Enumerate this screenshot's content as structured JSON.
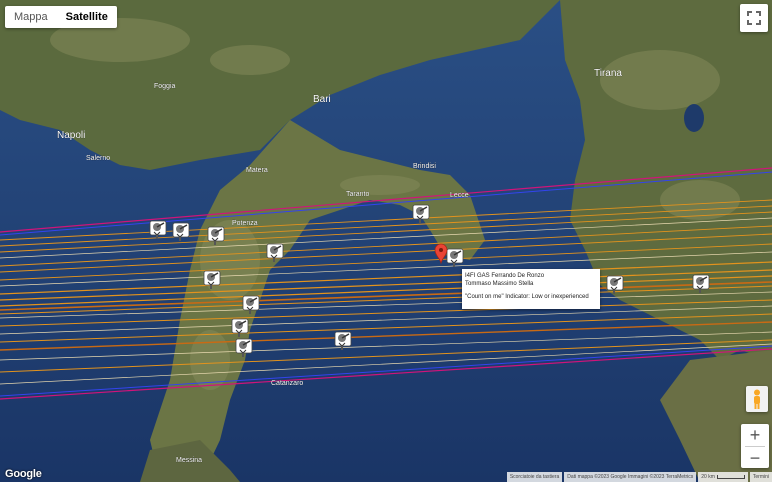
{
  "map_type_control": {
    "map_label": "Mappa",
    "satellite_label": "Satellite",
    "active": "satellite"
  },
  "cities": [
    {
      "name": "Bari"
    },
    {
      "name": "Napoli"
    },
    {
      "name": "Brindisi"
    },
    {
      "name": "Tirana"
    },
    {
      "name": "Salerno"
    },
    {
      "name": "Potenza"
    },
    {
      "name": "Taranto"
    },
    {
      "name": "Matera"
    },
    {
      "name": "Lecce"
    },
    {
      "name": "Catanzaro"
    },
    {
      "name": "Messina"
    },
    {
      "name": "Foggia"
    }
  ],
  "info_window": {
    "line1": "I4FI GAS Ferrando De Ronzo",
    "line2": "Tommaso Massimo Stella",
    "line3": "\"Count on me\" Indicator: Low or inexperienced"
  },
  "attribution": {
    "shortcuts": "Scorciatoie da tastiera",
    "data": "Dati mappa ©2023 Google Immagini ©2023 TerraMetrics",
    "scale": "20 km",
    "terms": "Termini"
  },
  "brand": "Google",
  "colors": {
    "accent_blue": "#3344ee",
    "line_orange": "#e3931d",
    "line_magenta": "#d0147a",
    "marker_red": "#ea4335"
  }
}
